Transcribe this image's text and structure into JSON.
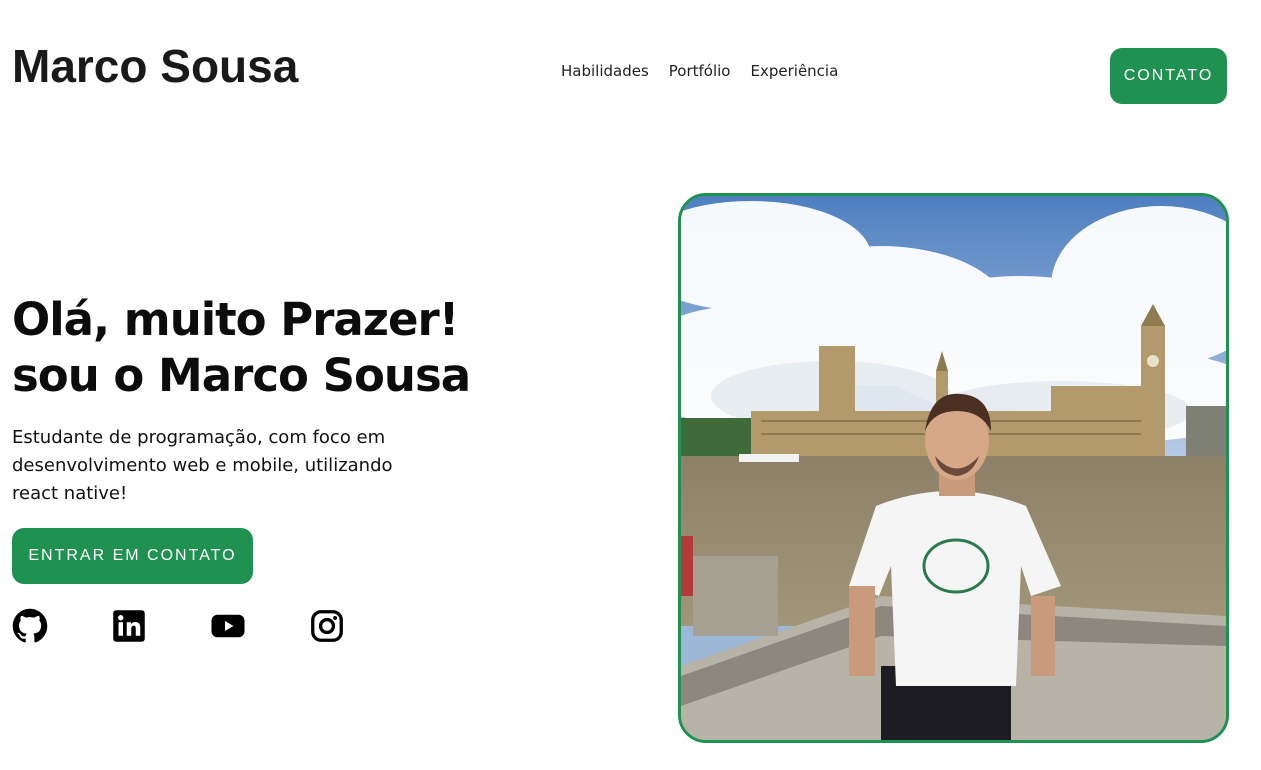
{
  "header": {
    "logo": "Marco Sousa",
    "nav": [
      "Habilidades",
      "Portfólio",
      "Experiência"
    ],
    "contact_button": "CONTATO"
  },
  "hero": {
    "title_line1": "Olá, muito Prazer!",
    "title_line2": "sou o Marco Sousa",
    "description": "Estudante de programação, com foco em desenvolvimento web e mobile, utilizando react native!",
    "cta_button": "ENTRAR EM CONTATO",
    "socials": [
      {
        "icon": "github-icon"
      },
      {
        "icon": "linkedin-icon"
      },
      {
        "icon": "youtube-icon"
      },
      {
        "icon": "instagram-icon"
      }
    ],
    "photo": {
      "alt": "Foto de Marco Sousa em frente ao Parlamento de Londres"
    }
  },
  "colors": {
    "accent": "#1f9150",
    "text": "#111111",
    "background": "#ffffff"
  }
}
